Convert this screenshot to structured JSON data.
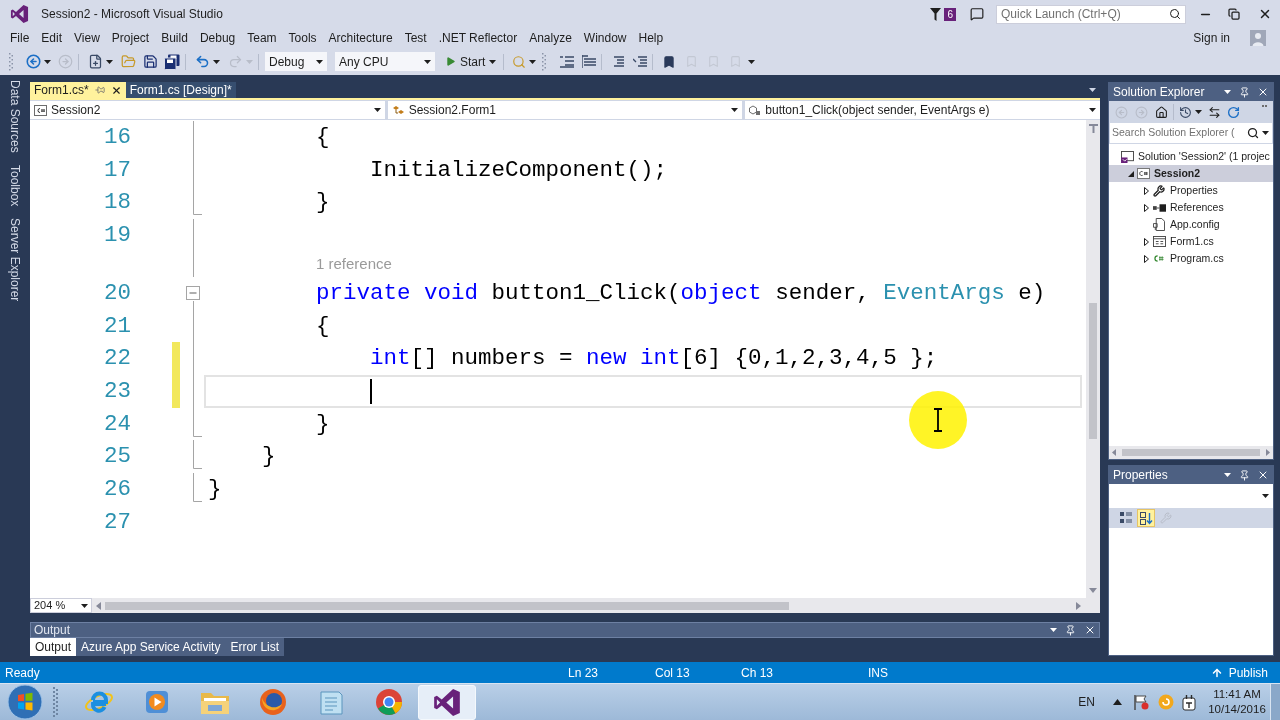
{
  "window": {
    "title": "Session2 - Microsoft Visual Studio"
  },
  "title_bar": {
    "notifications": "6",
    "quick_launch": {
      "placeholder": "Quick Launch (Ctrl+Q)"
    },
    "sign_in": "Sign in"
  },
  "menu": [
    "File",
    "Edit",
    "View",
    "Project",
    "Build",
    "Debug",
    "Team",
    "Tools",
    "Architecture",
    "Test",
    ".NET Reflector",
    "Analyze",
    "Window",
    "Help"
  ],
  "toolbar": {
    "configuration": "Debug",
    "platform": "Any CPU",
    "start": "Start"
  },
  "side_tabs": [
    "Data Sources",
    "Toolbox",
    "Server Explorer"
  ],
  "editor_tabs": [
    {
      "label": "Form1.cs*",
      "selected": true
    },
    {
      "label": "Form1.cs [Design]*",
      "selected": false
    }
  ],
  "nav_bar": {
    "project": "Session2",
    "class": "Session2.Form1",
    "member": "button1_Click(object sender, EventArgs e)"
  },
  "code": {
    "lines": [
      {
        "kind": "code",
        "number": "16",
        "tokens": [
          {
            "text": "        {",
            "kind": "plain"
          }
        ],
        "changed": false,
        "caret": false,
        "region_start": false,
        "region_end": false
      },
      {
        "kind": "code",
        "number": "17",
        "tokens": [
          {
            "text": "            InitializeComponent();",
            "kind": "plain"
          }
        ],
        "changed": false,
        "caret": false,
        "region_start": false,
        "region_end": false
      },
      {
        "kind": "code",
        "number": "18",
        "tokens": [
          {
            "text": "        }",
            "kind": "plain"
          }
        ],
        "changed": false,
        "caret": false,
        "region_start": false,
        "region_end": true
      },
      {
        "kind": "code",
        "number": "19",
        "changed": false,
        "caret": false,
        "region_start": false,
        "region_end": false
      },
      {
        "kind": "codelens",
        "text": "1 reference"
      },
      {
        "kind": "code",
        "number": "20",
        "tokens": [
          {
            "text": "        private void",
            "kind": "keyword"
          },
          {
            "text": " button1_Click(",
            "kind": "plain"
          },
          {
            "text": "object",
            "kind": "keyword"
          },
          {
            "text": " sender, ",
            "kind": "plain"
          },
          {
            "text": "EventArgs",
            "kind": "type"
          },
          {
            "text": " e)",
            "kind": "plain"
          }
        ],
        "changed": false,
        "caret": false,
        "region_start": true,
        "region_end": false
      },
      {
        "kind": "code",
        "number": "21",
        "tokens": [
          {
            "text": "        {",
            "kind": "plain"
          }
        ],
        "changed": false,
        "caret": false,
        "region_start": false,
        "region_end": false
      },
      {
        "kind": "code",
        "number": "22",
        "tokens": [
          {
            "text": "            int",
            "kind": "keyword"
          },
          {
            "text": "[] numbers = ",
            "kind": "plain"
          },
          {
            "text": "new int",
            "kind": "keyword"
          },
          {
            "text": "[6] {0,1,2,3,4,5 };",
            "kind": "plain"
          }
        ],
        "changed": true,
        "caret": false,
        "region_start": false,
        "region_end": false
      },
      {
        "kind": "code",
        "number": "23",
        "changed": true,
        "caret": true,
        "region_start": false,
        "region_end": false
      },
      {
        "kind": "code",
        "number": "24",
        "tokens": [
          {
            "text": "        }",
            "kind": "plain"
          }
        ],
        "changed": false,
        "caret": false,
        "region_start": false,
        "region_end": true
      },
      {
        "kind": "code",
        "number": "25",
        "tokens": [
          {
            "text": "    }",
            "kind": "plain"
          }
        ],
        "changed": false,
        "caret": false,
        "region_start": false,
        "region_end": true
      },
      {
        "kind": "code",
        "number": "26",
        "tokens": [
          {
            "text": "}",
            "kind": "plain"
          }
        ],
        "changed": false,
        "caret": false,
        "region_start": false,
        "region_end": true
      },
      {
        "kind": "code",
        "number": "27",
        "changed": false,
        "caret": false,
        "region_start": false,
        "region_end": false
      }
    ]
  },
  "zoom": "204 %",
  "output": {
    "title": "Output",
    "tabs": [
      {
        "label": "Output",
        "selected": true
      },
      {
        "label": "Azure App Service Activity",
        "selected": false
      },
      {
        "label": "Error List",
        "selected": false
      }
    ]
  },
  "solution_explorer": {
    "title": "Solution Explorer",
    "search": {
      "placeholder": "Search Solution Explorer ("
    },
    "tree": [
      {
        "label": "Solution 'Session2' (1 projec",
        "kind": "solution",
        "selected": false,
        "children": [
          {
            "label": "Session2",
            "kind": "project",
            "expanded": true,
            "selected": true,
            "children": [
              {
                "label": "Properties",
                "kind": "properties",
                "expanded": false,
                "selected": false
              },
              {
                "label": "References",
                "kind": "references",
                "expanded": false,
                "selected": false
              },
              {
                "label": "App.config",
                "kind": "config",
                "selected": false
              },
              {
                "label": "Form1.cs",
                "kind": "form",
                "expanded": false,
                "selected": false
              },
              {
                "label": "Program.cs",
                "kind": "csharp",
                "expanded": false,
                "selected": false
              }
            ]
          }
        ]
      }
    ]
  },
  "properties": {
    "title": "Properties",
    "tools": [
      {
        "kind": "categorized",
        "selected": false,
        "disabled": false
      },
      {
        "kind": "alphabetical",
        "selected": true,
        "disabled": false
      },
      {
        "kind": "property_pages",
        "selected": false,
        "disabled": true
      }
    ]
  },
  "status_bar": {
    "message": "Ready",
    "line": "Ln 23",
    "column": "Col 13",
    "character": "Ch 13",
    "mode": "INS",
    "publish": "Publish"
  },
  "taskbar": {
    "apps": [
      {
        "kind": "ie",
        "selected": false
      },
      {
        "kind": "media_player",
        "selected": false
      },
      {
        "kind": "explorer",
        "selected": false
      },
      {
        "kind": "firefox",
        "selected": false
      },
      {
        "kind": "notepad",
        "selected": false
      },
      {
        "kind": "chrome",
        "selected": false
      },
      {
        "kind": "visual_studio",
        "selected": true
      }
    ],
    "language": "EN",
    "time": "11:41 AM",
    "date": "10/14/2016"
  }
}
